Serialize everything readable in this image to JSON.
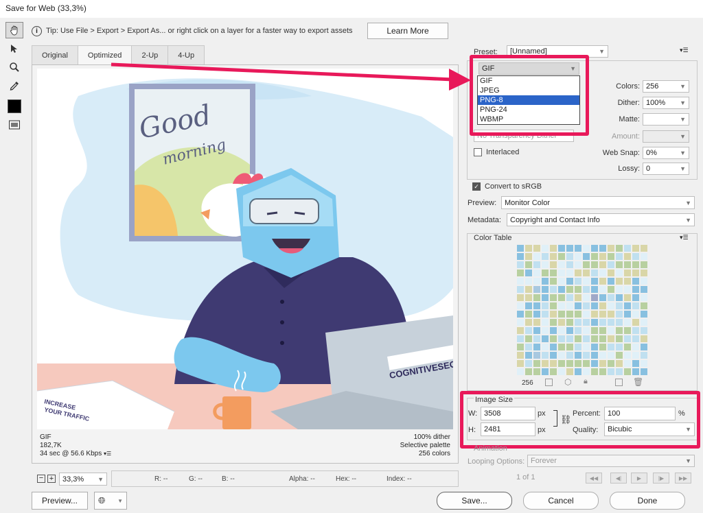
{
  "window": {
    "title": "Save for Web (33,3%)"
  },
  "tip": {
    "text": "Tip: Use File > Export > Export As...  or right click on a layer for a faster way to export assets",
    "learn_more": "Learn More"
  },
  "tabs": [
    "Original",
    "Optimized",
    "2-Up",
    "4-Up"
  ],
  "artwork": {
    "poster_line1": "Good",
    "poster_line2": "morning",
    "laptop_brand": "COGNITIVESEO",
    "flyer_line1": "INCREASE",
    "flyer_line2": "YOUR TRAFFIC"
  },
  "image_info": {
    "left": [
      "GIF",
      "182,7K",
      "34 sec @ 56.6 Kbps"
    ],
    "right": [
      "100% dither",
      "Selective palette",
      "256 colors"
    ]
  },
  "status": {
    "zoom": "33,3%",
    "r": "R: --",
    "g": "G: --",
    "b": "B: --",
    "alpha": "Alpha: --",
    "hex": "Hex: --",
    "index": "Index: --"
  },
  "preset": {
    "label": "Preset:",
    "value": "[Unnamed]"
  },
  "format": {
    "value": "GIF",
    "options": [
      "GIF",
      "JPEG",
      "PNG-8",
      "PNG-24",
      "WBMP"
    ],
    "selected_index": 2
  },
  "settings": {
    "colors_label": "Colors:",
    "colors_value": "256",
    "dither_label": "Dither:",
    "dither_value": "100%",
    "matte_label": "Matte:",
    "amount_label": "Amount:",
    "websnap_label": "Web Snap:",
    "websnap_value": "0%",
    "lossy_label": "Lossy:",
    "lossy_value": "0",
    "interlaced_label": "Interlaced",
    "partial_text": "No Transparency Dither"
  },
  "convert_srgb": "Convert to sRGB",
  "preview_label": "Preview:",
  "preview_value": "Monitor Color",
  "metadata_label": "Metadata:",
  "metadata_value": "Copyright and Contact Info",
  "color_table": {
    "title": "Color Table",
    "count": "256"
  },
  "image_size": {
    "title": "Image Size",
    "w_label": "W:",
    "w_value": "3508",
    "w_unit": "px",
    "h_label": "H:",
    "h_value": "2481",
    "h_unit": "px",
    "percent_label": "Percent:",
    "percent_value": "100",
    "percent_unit": "%",
    "quality_label": "Quality:",
    "quality_value": "Bicubic"
  },
  "animation": {
    "title": "Animation",
    "looping_label": "Looping Options:",
    "looping_value": "Forever",
    "frame": "1 of 1"
  },
  "buttons": {
    "preview": "Preview...",
    "save": "Save...",
    "cancel": "Cancel",
    "done": "Done"
  },
  "colors": {
    "highlight": "#e8195a",
    "selection": "#2b64c8",
    "character_blue": "#7cc8ee",
    "sweater": "#3f3a72"
  }
}
